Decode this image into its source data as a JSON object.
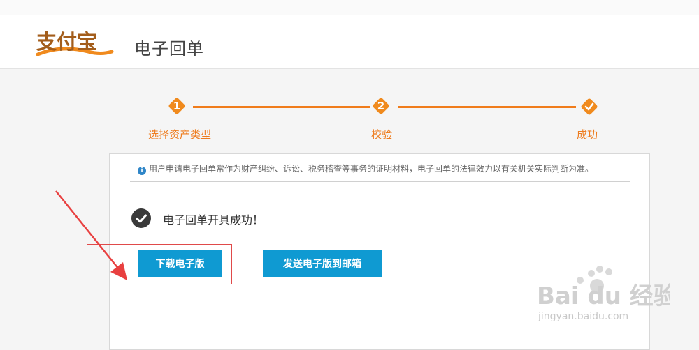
{
  "header": {
    "logo_text": "支付宝",
    "title": "电子回单"
  },
  "steps": [
    {
      "number": "1",
      "label": "选择资产类型",
      "state": "done"
    },
    {
      "number": "2",
      "label": "校验",
      "state": "done"
    },
    {
      "number": "",
      "label": "成功",
      "state": "done"
    }
  ],
  "card": {
    "notice": "用户申请电子回单常作为财产纠纷、诉讼、税务稽查等事务的证明材料，电子回单的法律效力以有关机关实际判断为准。",
    "success_message": "电子回单开具成功！",
    "download_button": "下载电子版",
    "email_button": "发送电子版到邮箱"
  },
  "watermark": {
    "brand": "Bai du 经验",
    "url": "jingyan.baidu.com"
  },
  "colors": {
    "accent": "#f07c1b",
    "button": "#0f9ad2",
    "annotation": "#e04a4a"
  }
}
